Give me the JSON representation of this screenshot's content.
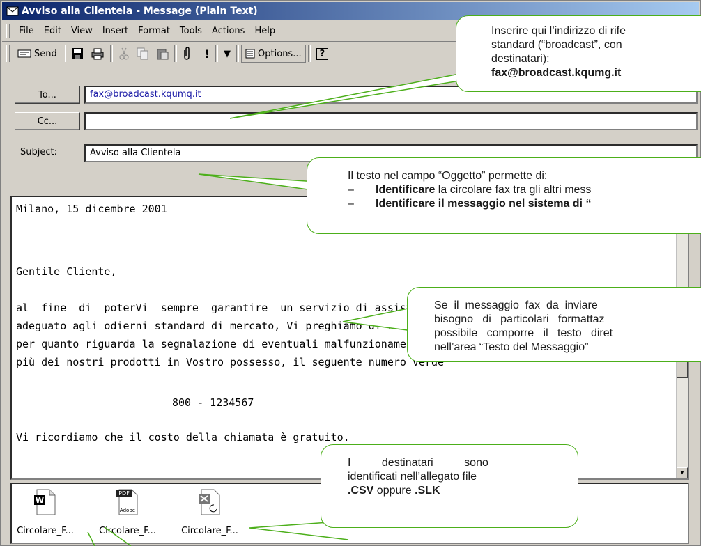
{
  "window": {
    "title": "Avviso alla Clientela - Message (Plain Text)"
  },
  "menu": {
    "items": [
      "File",
      "Edit",
      "View",
      "Insert",
      "Format",
      "Tools",
      "Actions",
      "Help"
    ]
  },
  "toolbar": {
    "send_label": "Send",
    "options_label": "Options...",
    "help_glyph": "?"
  },
  "header": {
    "to_button": "To...",
    "to_value": "fax@broadcast.kqumq.it",
    "cc_button": "Cc...",
    "cc_value": "",
    "subject_label": "Subject:",
    "subject_value": "Avviso alla Clientela"
  },
  "body": {
    "lines": [
      "Milano, 15 dicembre 2001",
      "Gentile Cliente,",
      "al  fine  di  poterVi  sempre  garantire  un servizio di assistenza tecnica",
      "adeguato agli odierni standard di mercato, Vi preghiamo di riferirvi",
      "per quanto riguarda la segnalazione di eventuali malfunzionamenti di uno o",
      "più dei nostri prodotti in Vostro possesso, il seguente numero verde",
      "800 - 1234567",
      "Vi ricordiamo che il costo della chiamata è gratuito."
    ]
  },
  "attachments": [
    {
      "name": "Circolare_F...",
      "icon": "word-document-icon"
    },
    {
      "name": "Circolare_F...",
      "icon": "pdf-document-icon"
    },
    {
      "name": "Circolare_F...",
      "icon": "excel-slk-document-icon"
    }
  ],
  "callouts": {
    "address": {
      "line1": "Inserire qui l’indirizzo di rife",
      "line2": "standard (“broadcast”, con",
      "line3": "destinatari):",
      "line4": "fax@broadcast.kqumg.it"
    },
    "subject": {
      "intro": "Il testo nel campo “Oggetto” permette di:",
      "b1_bold": "Identificare",
      "b1_rest": " la circolare fax tra gli altri mess",
      "b2_bold": "Identificare il messaggio nel sistema di “"
    },
    "body": {
      "line1": "Se  il  messaggio  fax  da  inviare",
      "line2": "bisogno   di   particolari   formattaz",
      "line3": "possibile   comporre   il   testo   diret",
      "line4": "nell’area “Testo del Messaggio”"
    },
    "attach": {
      "line1": "I          destinatari          sono",
      "line2": "identificati nell’allegato file",
      "line3_bold1": ".CSV",
      "line3_mid": " oppure ",
      "line3_bold2": ".SLK"
    }
  },
  "colors": {
    "callout_border": "#4caf1a",
    "title_start": "#0a246a",
    "title_end": "#a6caf0"
  }
}
